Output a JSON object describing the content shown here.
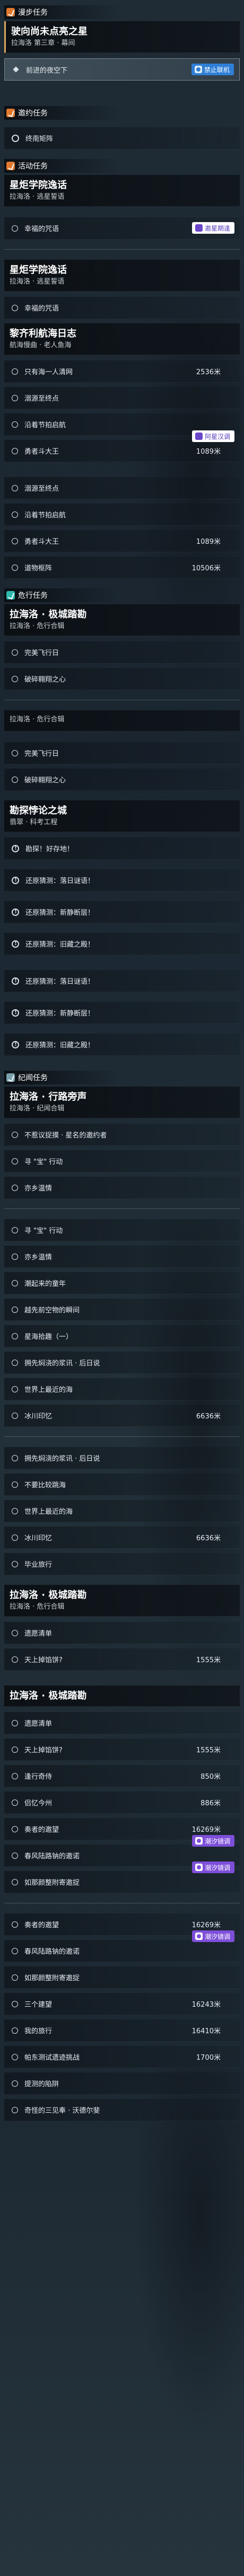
{
  "colors": {
    "orange_badge": "#e0782d",
    "teal_badge": "#2fb8b0",
    "blue_tag": "#2f7fd6",
    "purple_tag": "#7d4fd9",
    "accent_border": "#d9a85b"
  },
  "sections": {
    "s1": "漫步任务",
    "s2": "邀约任务",
    "s3": "活动任务",
    "s4": "危行任务",
    "s5": "纪闻任务"
  },
  "tags": {
    "online": "禁止联机",
    "invite": "邀星期逢",
    "invite2": "阿星汉调",
    "tide": "潮汐镜调"
  },
  "cards": {
    "c1": {
      "title": "驶向尚未点亮之星",
      "sub": "拉海洛 第三章 · 幕间"
    },
    "c2": {
      "title": "星炬学院逸话",
      "sub": "拉海洛 · 逃星誓语"
    },
    "c3": {
      "title": "星炬学院逸话",
      "sub": "拉海洛 · 逃星誓语"
    },
    "c4": {
      "title": "黎齐利航海日志",
      "sub": "航海慢曲 · 老人鱼海"
    },
    "c5": {
      "title": "拉海洛 · 极城踏勘",
      "sub": "拉海洛 · 危行合辑"
    },
    "c6": {
      "title": "拉海洛 · 危行合辑",
      "sub": ""
    },
    "c7": {
      "title": "勘探悖论之城",
      "sub": "翡翠 · 科考工程"
    },
    "c8": {
      "title": "拉海洛 · 行路旁声",
      "sub": "拉海洛 · 纪闻合辑"
    },
    "c9": {
      "title": "拉海洛 · 极城踏勘",
      "sub": "拉海洛 · 危行合辑"
    },
    "c10": {
      "title": "拉海洛 · 极城踏勘",
      "sub": ""
    }
  },
  "rows": {
    "r1": "前进的夜空下",
    "r2": "终南矩阵",
    "r3": "幸福的咒语",
    "r4": "幸福的咒语",
    "r5": "只有海一人清网",
    "r6": "溺源至终点",
    "r7": "沿着节拍启航",
    "r8": "勇者斗大王",
    "r9": "溺源至终点",
    "r10": "沿着节拍启航",
    "r11": "勇者斗大王",
    "r12": "道物枢阵",
    "r13": "完美飞行日",
    "r14": "破碎翱翔之心",
    "r15": "完美飞行日",
    "r16": "破碎翱翔之心",
    "r17": "勘探！好存地！",
    "r18": "还原猜测：落日谜语！",
    "r19": "还原猜测：新静断层！",
    "r20": "还原猜测：旧藏之殿！",
    "r21": "还原猜测：落日谜语！",
    "r22": "还原猜测：新静断层！",
    "r23": "还原猜测：旧藏之殿！",
    "r24": "不惹议捉摸 · 星名的邀约者",
    "r25": "寻 \"宝\" 行动",
    "r26": "亦乡温情",
    "r27": "寻 \"宝\" 行动",
    "r28": "亦乡温情",
    "r29": "潮起来的童年",
    "r30": "越先前空物的瞬间",
    "r31": "星海拾趣（一）",
    "r32": "拥先焖浇的浆讯 · 后日说",
    "r33": "世界上最近的海",
    "r34": "冰川印忆",
    "r35": "拥先焖浇的浆讯 · 后日说",
    "r36": "不要比较跳海",
    "r37": "世界上最近的海",
    "r38": "冰川印忆",
    "r39": "毕业旅行",
    "r40": "遗愿清单",
    "r41": "天上掉馅饼?",
    "r42": "遗愿清单",
    "r43": "天上掉馅饼?",
    "r44": "逢行奇侍",
    "r45": "侣忆今州",
    "r46": "奏者的邀望",
    "r47": "春风陆路钠的邀诺",
    "r48": "如那颜整附寄邀捉",
    "r49": "奏者的邀望",
    "r50": "春风陆路钠的邀诺",
    "r51": "如那颜整附寄邀捉",
    "r52": "三个建望",
    "r53": "我的旅行",
    "r54": "帕东测试遗迹挑战",
    "r55": "提测的陷阱",
    "r56": "奇怪的三见奉 · 沃德尔斐"
  },
  "dist": {
    "d1": "2536米",
    "d2": "1089米",
    "d3": "1089米",
    "d4": "10506米",
    "d5": "6636米",
    "d6": "6636米",
    "d7": "1555米",
    "d8": "1555米",
    "d9": "850米",
    "d10": "886米",
    "d11": "16269米",
    "d12": "16269米",
    "d13": "16243米",
    "d14": "16410米",
    "d15": "1700米"
  }
}
